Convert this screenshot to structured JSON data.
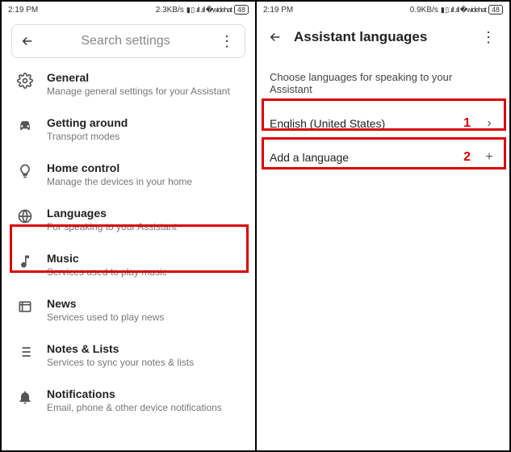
{
  "left": {
    "status": {
      "time": "2:19 PM",
      "net": "2.3KB/s",
      "battery": "48"
    },
    "search_placeholder": "Search settings",
    "items": [
      {
        "title": "General",
        "sub": "Manage general settings for your Assistant"
      },
      {
        "title": "Getting around",
        "sub": "Transport modes"
      },
      {
        "title": "Home control",
        "sub": "Manage the devices in your home"
      },
      {
        "title": "Languages",
        "sub": "For speaking to your Assistant"
      },
      {
        "title": "Music",
        "sub": "Services used to play music"
      },
      {
        "title": "News",
        "sub": "Services used to play news"
      },
      {
        "title": "Notes & Lists",
        "sub": "Services to sync your notes & lists"
      },
      {
        "title": "Notifications",
        "sub": "Email, phone & other device notifications"
      }
    ]
  },
  "right": {
    "status": {
      "time": "2:19 PM",
      "net": "0.9KB/s",
      "battery": "48"
    },
    "title": "Assistant languages",
    "instruction": "Choose languages for speaking to your Assistant",
    "rows": [
      {
        "label": "English (United States)",
        "annotation": "1",
        "icon": "chevron"
      },
      {
        "label": "Add a language",
        "annotation": "2",
        "icon": "plus"
      }
    ]
  }
}
